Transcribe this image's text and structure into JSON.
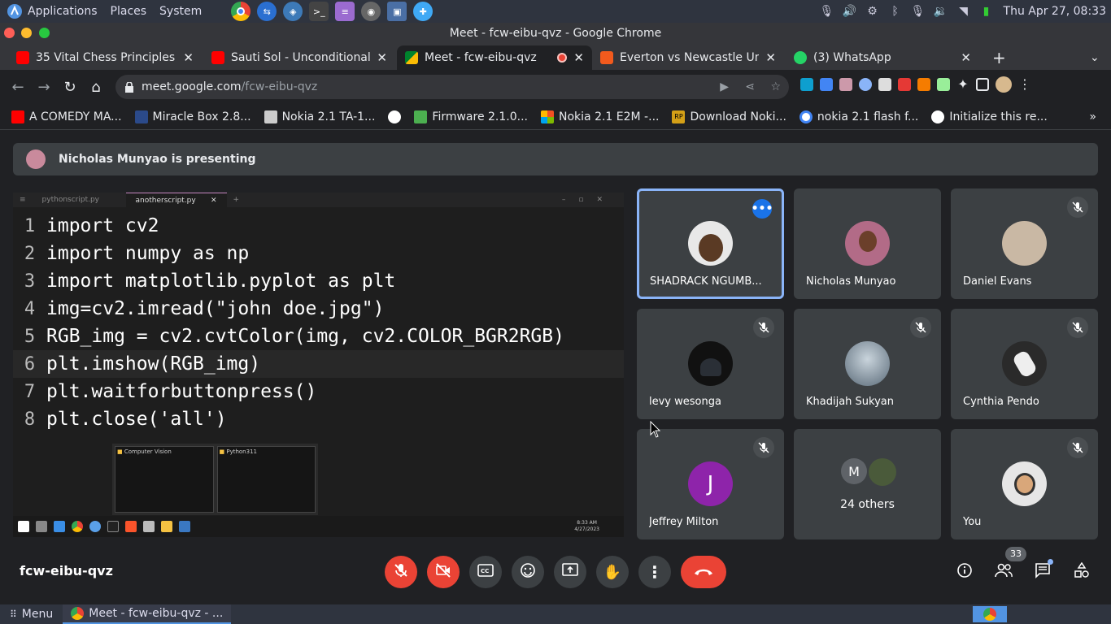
{
  "system_panel": {
    "menus": [
      "Applications",
      "Places",
      "System"
    ],
    "clock": "Thu Apr 27, 08:33"
  },
  "window": {
    "title": "Meet - fcw-eibu-qvz - Google Chrome"
  },
  "tabs": [
    {
      "title": "35 Vital Chess Principles |",
      "favicon_color": "#ff0000"
    },
    {
      "title": "Sauti Sol - Unconditionally",
      "favicon_color": "#ff0000"
    },
    {
      "title": "Meet - fcw-eibu-qvz",
      "favicon_color": "#00832d",
      "active": true
    },
    {
      "title": "Everton vs Newcastle Unite",
      "favicon_color": "#f25a1d"
    },
    {
      "title": "(3) WhatsApp",
      "favicon_color": "#25d366"
    }
  ],
  "address_bar": {
    "domain": "meet.google.com",
    "path": "/fcw-eibu-qvz"
  },
  "bookmarks": [
    {
      "label": "A COMEDY MA...",
      "color": "#ff0000"
    },
    {
      "label": "Miracle Box 2.8...",
      "color": "#2b4a8a"
    },
    {
      "label": "Nokia 2.1 TA-1...",
      "color": "#cccccc"
    },
    {
      "label": "",
      "color": "#ffffff"
    },
    {
      "label": "Firmware 2.1.0...",
      "color": "#4caf50"
    },
    {
      "label": "Nokia 2.1 E2M -...",
      "color": "#f25022"
    },
    {
      "label": "Download Noki...",
      "color": "#d4a017"
    },
    {
      "label": "nokia 2.1 flash f...",
      "color": "#4285f4"
    },
    {
      "label": "Initialize this re...",
      "color": "#ffffff"
    }
  ],
  "presenting_banner": "Nicholas Munyao is presenting",
  "shared_screen": {
    "editor_tabs": [
      "pythonscript.py",
      "anotherscript.py"
    ],
    "code_lines": [
      {
        "num": "1",
        "text": "import cv2"
      },
      {
        "num": "2",
        "text": "import numpy as np"
      },
      {
        "num": "3",
        "text": "import matplotlib.pyplot as plt"
      },
      {
        "num": "4",
        "text": "img=cv2.imread(\"john doe.jpg\")"
      },
      {
        "num": "5",
        "text": "RGB_img = cv2.cvtColor(img, cv2.COLOR_BGR2RGB)"
      },
      {
        "num": "6",
        "text": "plt.imshow(RGB_img)"
      },
      {
        "num": "7",
        "text": "plt.waitforbuttonpress()"
      },
      {
        "num": "8",
        "text": "plt.close('all')"
      }
    ],
    "thumbnails": [
      "Computer Vision",
      "Python311"
    ],
    "taskbar_time": "8:33 AM",
    "taskbar_date": "4/27/2023"
  },
  "participants": [
    {
      "name": "SHADRACK NGUMB...",
      "avatar_color": "#e8e8e8",
      "speaking": true,
      "muted": false
    },
    {
      "name": "Nicholas Munyao",
      "avatar_color": "#b26b87",
      "muted": false
    },
    {
      "name": "Daniel Evans",
      "avatar_color": "#c9b8a4",
      "muted": true
    },
    {
      "name": "levy wesonga",
      "avatar_color": "#111111",
      "muted": true
    },
    {
      "name": "Khadijah Sukyan",
      "avatar_color": "#7a8a99",
      "muted": true
    },
    {
      "name": "Cynthia Pendo",
      "avatar_color": "#2a2a2a",
      "muted": true
    },
    {
      "name": "Jeffrey Milton",
      "avatar_color": "#8e24aa",
      "initial": "J",
      "muted": true
    },
    {
      "name": "24 others",
      "initial": "M",
      "muted": false
    },
    {
      "name": "You",
      "avatar_color": "#e6e6e6",
      "muted": true
    }
  ],
  "meeting_code": "fcw-eibu-qvz",
  "participant_count": "33",
  "bottom_panel": {
    "menu_label": "Menu",
    "task_label": "Meet - fcw-eibu-qvz - ..."
  }
}
